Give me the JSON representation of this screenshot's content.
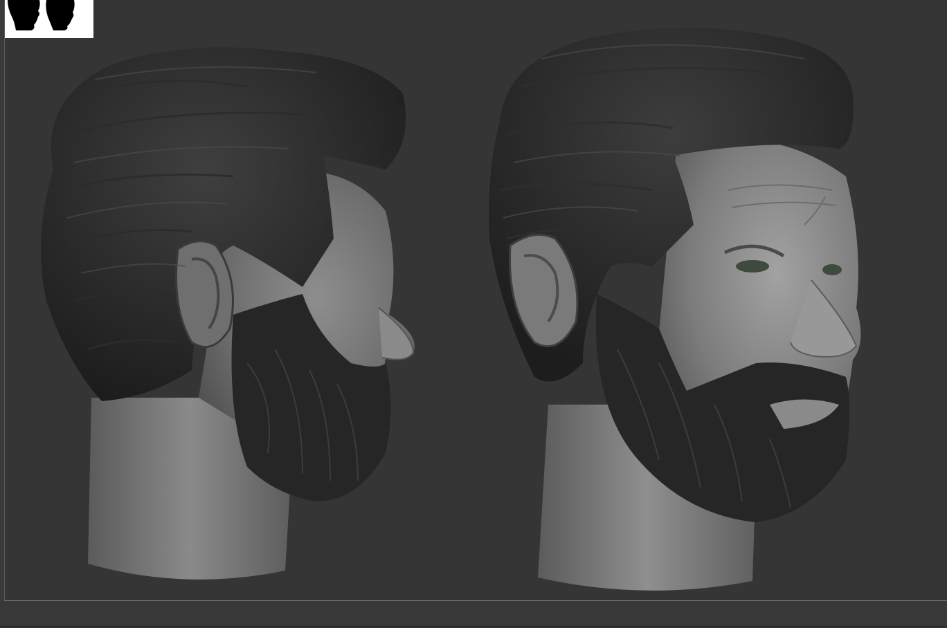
{
  "app": {
    "window_title": ""
  },
  "viewport": {
    "background": "#353535",
    "models": [
      {
        "name": "head-sculpt-side-view"
      },
      {
        "name": "head-sculpt-three-quarter-view"
      }
    ]
  },
  "thumbnail": {
    "icon": "silhouette-icon",
    "background": "#ffffff"
  }
}
